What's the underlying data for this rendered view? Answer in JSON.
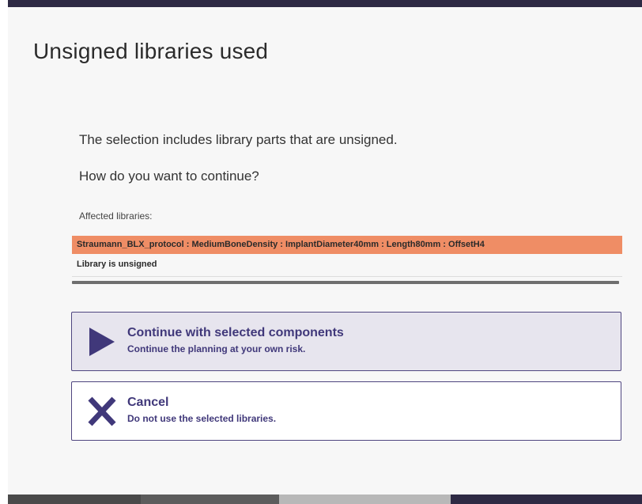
{
  "dialog": {
    "title": "Unsigned libraries used",
    "message_line1": "The selection includes library parts that are unsigned.",
    "message_line2": "How do you want to continue?",
    "affected_label": "Affected libraries:"
  },
  "libraries": [
    {
      "name": "Straumann_BLX_protocol : MediumBoneDensity : ImplantDiameter40mm : Length80mm : OffsetH4",
      "status": "Library is unsigned"
    }
  ],
  "options": {
    "continue": {
      "title": "Continue with selected components",
      "subtitle": "Continue the planning at your own risk.",
      "icon": "play-icon"
    },
    "cancel": {
      "title": "Cancel",
      "subtitle": "Do not use the selected libraries.",
      "icon": "close-icon"
    }
  },
  "colors": {
    "accent": "#40387a",
    "warning_row": "#ef8d65",
    "dialog_bg": "#f7f7f7",
    "selected_option_bg": "#e7e5ee"
  }
}
